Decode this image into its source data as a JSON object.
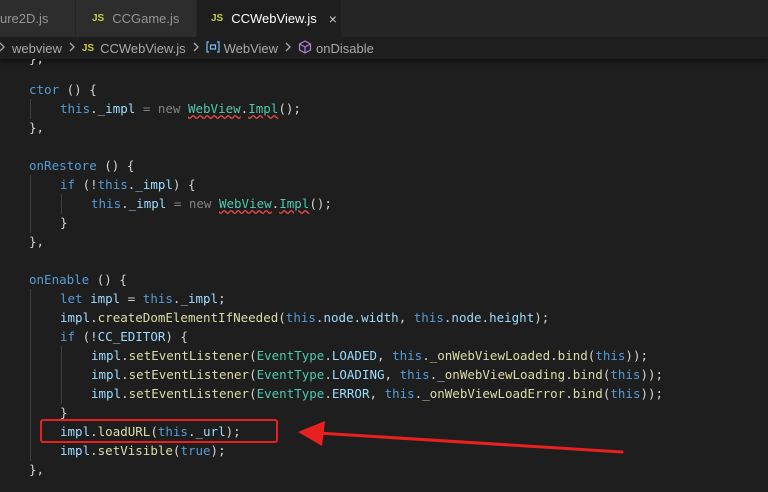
{
  "tabs": [
    {
      "label": "ure2D.js",
      "active": false
    },
    {
      "label": "CCGame.js",
      "active": false
    },
    {
      "label": "CCWebView.js",
      "active": true
    }
  ],
  "tab_badge": "JS",
  "close_glyph": "×",
  "breadcrumb": {
    "folder": "webview",
    "file": "CCWebView.js",
    "class": "WebView",
    "method": "onDisable"
  },
  "code": {
    "ctor": "ctor",
    "onRestore": "onRestore",
    "onEnable": "onEnable",
    "WebView": "WebView",
    "Impl": "Impl",
    "createDomElementIfNeeded": "createDomElementIfNeeded",
    "CC_EDITOR": "CC_EDITOR",
    "EventType": "EventType",
    "setEventListener": "setEventListener",
    "LOADED": "LOADED",
    "LOADING": "LOADING",
    "ERROR": "ERROR",
    "_onWebViewLoaded": "_onWebViewLoaded",
    "_onWebViewLoading": "_onWebViewLoading",
    "_onWebViewLoadError": "_onWebViewLoadError",
    "loadURL": "loadURL",
    "_url": "_url",
    "setVisible": "setVisible"
  },
  "colors": {
    "annotation": "#e82020",
    "keyword": "#569cd6",
    "function": "#dcdcaa",
    "variable": "#9cdcfe",
    "type": "#4ec9b0"
  }
}
